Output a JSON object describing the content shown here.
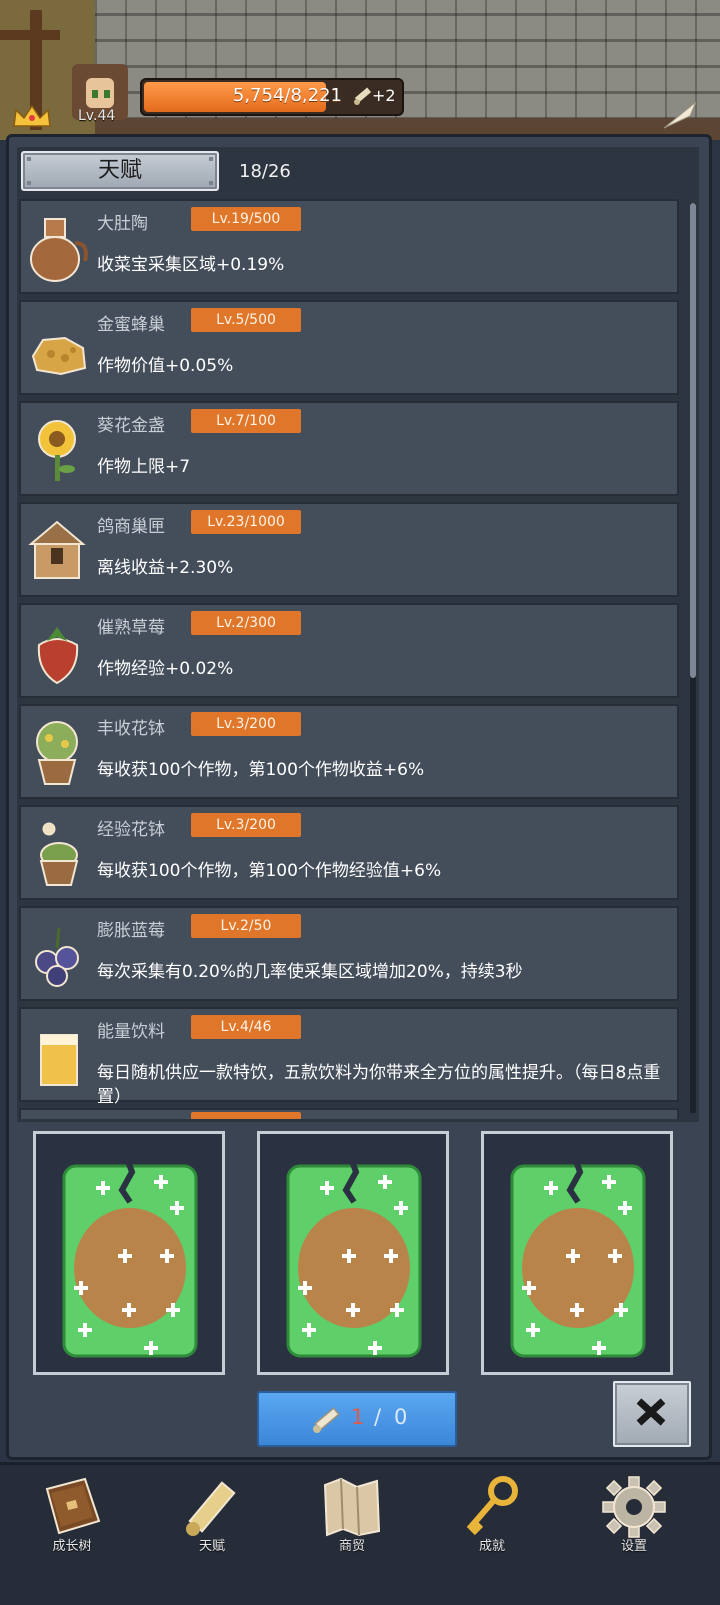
{
  "header": {
    "level_label": "Lv.44",
    "xp_text": "5,754/8,221",
    "xp_progress": 0.7,
    "scroll_bonus": "+2"
  },
  "panel": {
    "tab_label": "天赋",
    "count_text": "18/26",
    "items": [
      {
        "name": "大肚陶",
        "level": "Lv.19/500",
        "desc": "收菜宝采集区域+0.19%",
        "icon": "clay-jar-icon"
      },
      {
        "name": "金蜜蜂巢",
        "level": "Lv.5/500",
        "desc": "作物价值+0.05%",
        "icon": "honeycomb-icon"
      },
      {
        "name": "葵花金盏",
        "level": "Lv.7/100",
        "desc": "作物上限+7",
        "icon": "sunflower-icon"
      },
      {
        "name": "鸽商巢匣",
        "level": "Lv.23/1000",
        "desc": "离线收益+2.30%",
        "icon": "birdhouse-icon"
      },
      {
        "name": "催熟草莓",
        "level": "Lv.2/300",
        "desc": "作物经验+0.02%",
        "icon": "strawberry-icon"
      },
      {
        "name": "丰收花钵",
        "level": "Lv.3/200",
        "desc": "每收获100个作物，第100个作物收益+6%",
        "icon": "flower-pot-icon"
      },
      {
        "name": "经验花钵",
        "level": "Lv.3/200",
        "desc": "每收获100个作物，第100个作物经验值+6%",
        "icon": "exp-pot-icon"
      },
      {
        "name": "膨胀蓝莓",
        "level": "Lv.2/50",
        "desc": "每次采集有0.20%的几率使采集区域增加20%，持续3秒",
        "icon": "blueberry-icon"
      },
      {
        "name": "能量饮料",
        "level": "Lv.4/46",
        "desc": "每日随机供应一款特饮，五款饮料为你带来全方位的属性提升。（每日8点重置）",
        "icon": "energy-drink-icon"
      }
    ]
  },
  "cards": [
    {
      "name": "card-1"
    },
    {
      "name": "card-2"
    },
    {
      "name": "card-3"
    }
  ],
  "use_button": {
    "current": "1",
    "sep": "/",
    "total": "0"
  },
  "nav": [
    {
      "label": "成长树",
      "icon": "book-icon"
    },
    {
      "label": "天赋",
      "icon": "scroll-icon"
    },
    {
      "label": "商贸",
      "icon": "map-icon"
    },
    {
      "label": "成就",
      "icon": "key-icon"
    },
    {
      "label": "设置",
      "icon": "gear-icon"
    }
  ],
  "colors": {
    "badge": "#e0762a",
    "xp_fill": "#f08a3a",
    "use_button": "#4a95e4",
    "card_green": "#5fcf6a",
    "card_soil": "#b8844a"
  }
}
